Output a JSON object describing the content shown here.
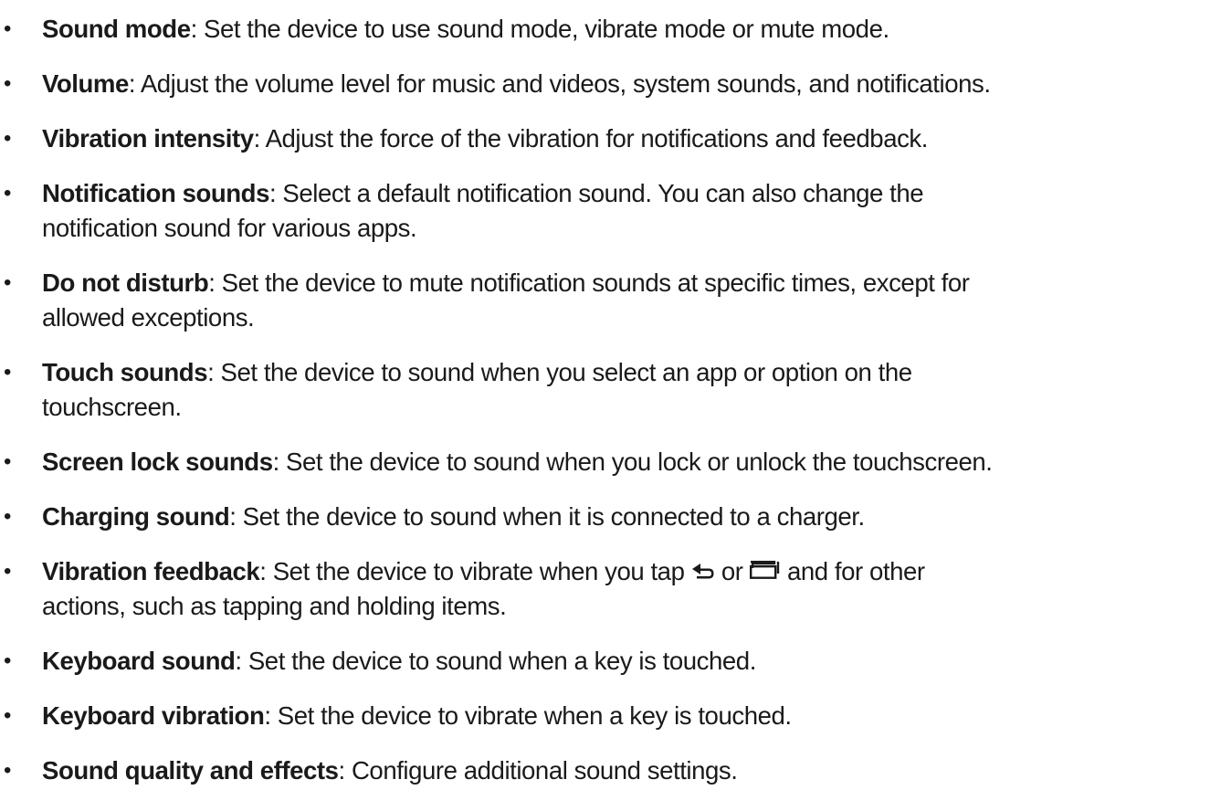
{
  "items": [
    {
      "term": "Sound mode",
      "desc": ": Set the device to use sound mode, vibrate mode or mute mode."
    },
    {
      "term": "Volume",
      "desc": ": Adjust the volume level for music and videos, system sounds, and notifications."
    },
    {
      "term": "Vibration intensity",
      "desc": ": Adjust the force of the vibration for notifications and feedback."
    },
    {
      "term": "Notification sounds",
      "desc": ": Select a default notification sound. You can also change the",
      "desc2": "notification sound for various apps."
    },
    {
      "term": "Do not disturb",
      "desc": ": Set the device to mute notification sounds at specific times, except for",
      "desc2": "allowed exceptions."
    },
    {
      "term": "Touch sounds",
      "desc": ": Set the device to sound when you select an app or option on the",
      "desc2": "touchscreen."
    },
    {
      "term": "Screen lock sounds",
      "desc": ": Set the device to sound when you lock or unlock the touchscreen."
    },
    {
      "term": "Charging sound",
      "desc": ": Set the device to sound when it is connected to a charger."
    },
    {
      "term": "Vibration feedback",
      "desc_a": ": Set the device to vibrate when you tap ",
      "desc_b": " or ",
      "desc_c": " and for other",
      "desc2": "actions, such as tapping and holding items.",
      "icon_1": "back-icon",
      "icon_2": "recent-apps-icon"
    },
    {
      "term": "Keyboard sound",
      "desc": ": Set the device to sound when a key is touched."
    },
    {
      "term": "Keyboard vibration",
      "desc": ": Set the device to vibrate when a key is touched."
    },
    {
      "term": "Sound quality and effects",
      "desc": ": Configure additional sound settings."
    }
  ],
  "bullet": "•"
}
